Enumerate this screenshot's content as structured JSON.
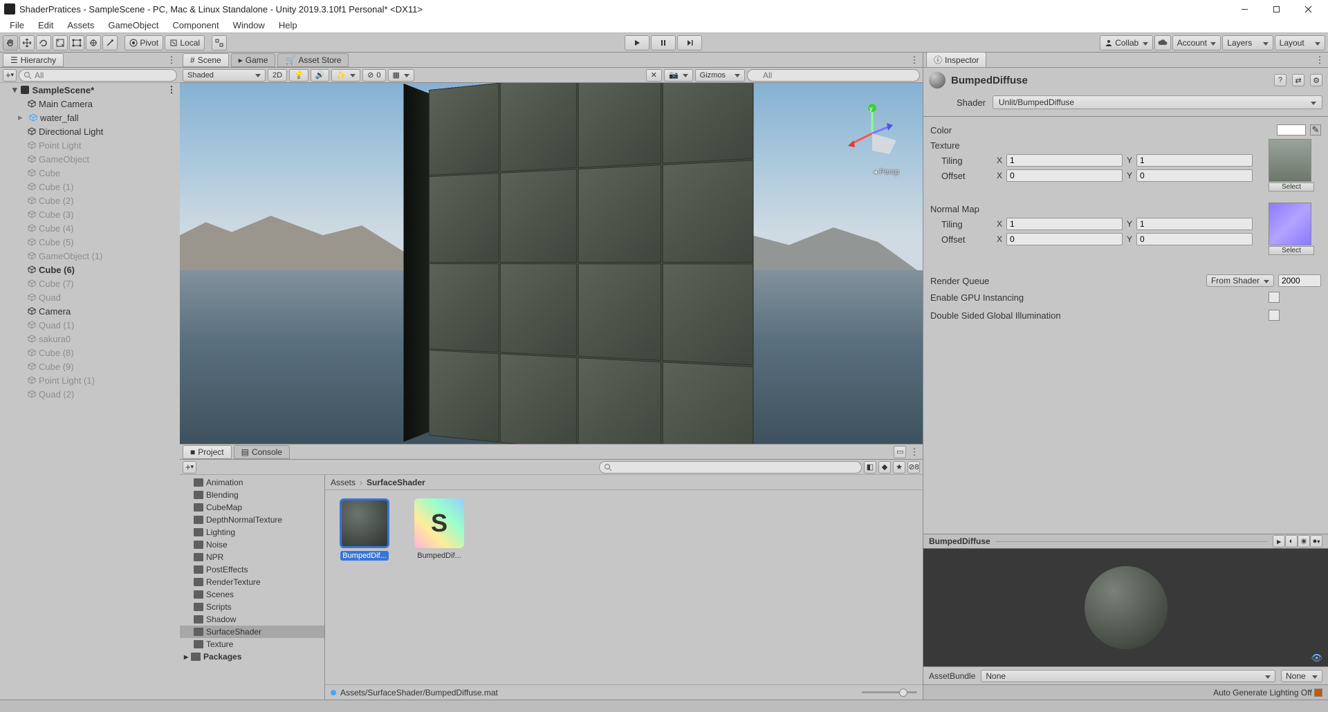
{
  "titlebar": "ShaderPratices - SampleScene - PC, Mac & Linux Standalone - Unity 2019.3.10f1 Personal* <DX11>",
  "menus": [
    "File",
    "Edit",
    "Assets",
    "GameObject",
    "Component",
    "Window",
    "Help"
  ],
  "toolbar": {
    "pivot": "Pivot",
    "local": "Local",
    "collab": "Collab",
    "account": "Account",
    "layers": "Layers",
    "layout": "Layout"
  },
  "hierarchy": {
    "tab": "Hierarchy",
    "search_placeholder": "All",
    "scene": "SampleScene*",
    "items": [
      {
        "label": "Main Camera",
        "dim": false
      },
      {
        "label": "water_fall",
        "dim": false,
        "color": "#4ea5ff",
        "expandable": true
      },
      {
        "label": "Directional Light",
        "dim": false
      },
      {
        "label": "Point Light",
        "dim": true
      },
      {
        "label": "GameObject",
        "dim": true
      },
      {
        "label": "Cube",
        "dim": true
      },
      {
        "label": "Cube (1)",
        "dim": true
      },
      {
        "label": "Cube (2)",
        "dim": true
      },
      {
        "label": "Cube (3)",
        "dim": true
      },
      {
        "label": "Cube (4)",
        "dim": true
      },
      {
        "label": "Cube (5)",
        "dim": true
      },
      {
        "label": "GameObject (1)",
        "dim": true
      },
      {
        "label": "Cube (6)",
        "dim": false,
        "bold": true
      },
      {
        "label": "Cube (7)",
        "dim": true
      },
      {
        "label": "Quad",
        "dim": true
      },
      {
        "label": "Camera",
        "dim": false
      },
      {
        "label": "Quad (1)",
        "dim": true
      },
      {
        "label": "sakura0",
        "dim": true
      },
      {
        "label": "Cube (8)",
        "dim": true
      },
      {
        "label": "Cube (9)",
        "dim": true
      },
      {
        "label": "Point Light (1)",
        "dim": true
      },
      {
        "label": "Quad (2)",
        "dim": true
      }
    ]
  },
  "scene": {
    "tabs": [
      "Scene",
      "Game",
      "Asset Store"
    ],
    "shading": "Shaded",
    "mode2d": "2D",
    "fx_count": "0",
    "gizmos": "Gizmos",
    "search_placeholder": "All",
    "projection": "Persp"
  },
  "project": {
    "tabs": [
      "Project",
      "Console"
    ],
    "lock_count": "8",
    "folders": [
      "Animation",
      "Blending",
      "CubeMap",
      "DepthNormalTexture",
      "Lighting",
      "Noise",
      "NPR",
      "PostEffects",
      "RenderTexture",
      "Scenes",
      "Scripts",
      "Shadow",
      "SurfaceShader",
      "Texture"
    ],
    "packages": "Packages",
    "breadcrumb_root": "Assets",
    "breadcrumb_leaf": "SurfaceShader",
    "assets": [
      {
        "label": "BumpedDif...",
        "kind": "mat",
        "selected": true
      },
      {
        "label": "BumpedDif...",
        "kind": "shader",
        "selected": false
      }
    ],
    "status_path": "Assets/SurfaceShader/BumpedDiffuse.mat"
  },
  "inspector": {
    "tab": "Inspector",
    "material_name": "BumpedDiffuse",
    "shader_label": "Shader",
    "shader_value": "Unlit/BumpedDiffuse",
    "color_label": "Color",
    "texture_label": "Texture",
    "normal_label": "Normal Map",
    "tiling_label": "Tiling",
    "offset_label": "Offset",
    "select_label": "Select",
    "x": "X",
    "y": "Y",
    "tex_tiling_x": "1",
    "tex_tiling_y": "1",
    "tex_offset_x": "0",
    "tex_offset_y": "0",
    "nrm_tiling_x": "1",
    "nrm_tiling_y": "1",
    "nrm_offset_x": "0",
    "nrm_offset_y": "0",
    "render_queue_label": "Render Queue",
    "render_queue_mode": "From Shader",
    "render_queue_value": "2000",
    "gpu_instancing": "Enable GPU Instancing",
    "double_sided": "Double Sided Global Illumination",
    "preview_title": "BumpedDiffuse",
    "asset_bundle": "AssetBundle",
    "asset_bundle_value": "None",
    "asset_bundle_variant": "None",
    "lighting_status": "Auto Generate Lighting Off"
  }
}
